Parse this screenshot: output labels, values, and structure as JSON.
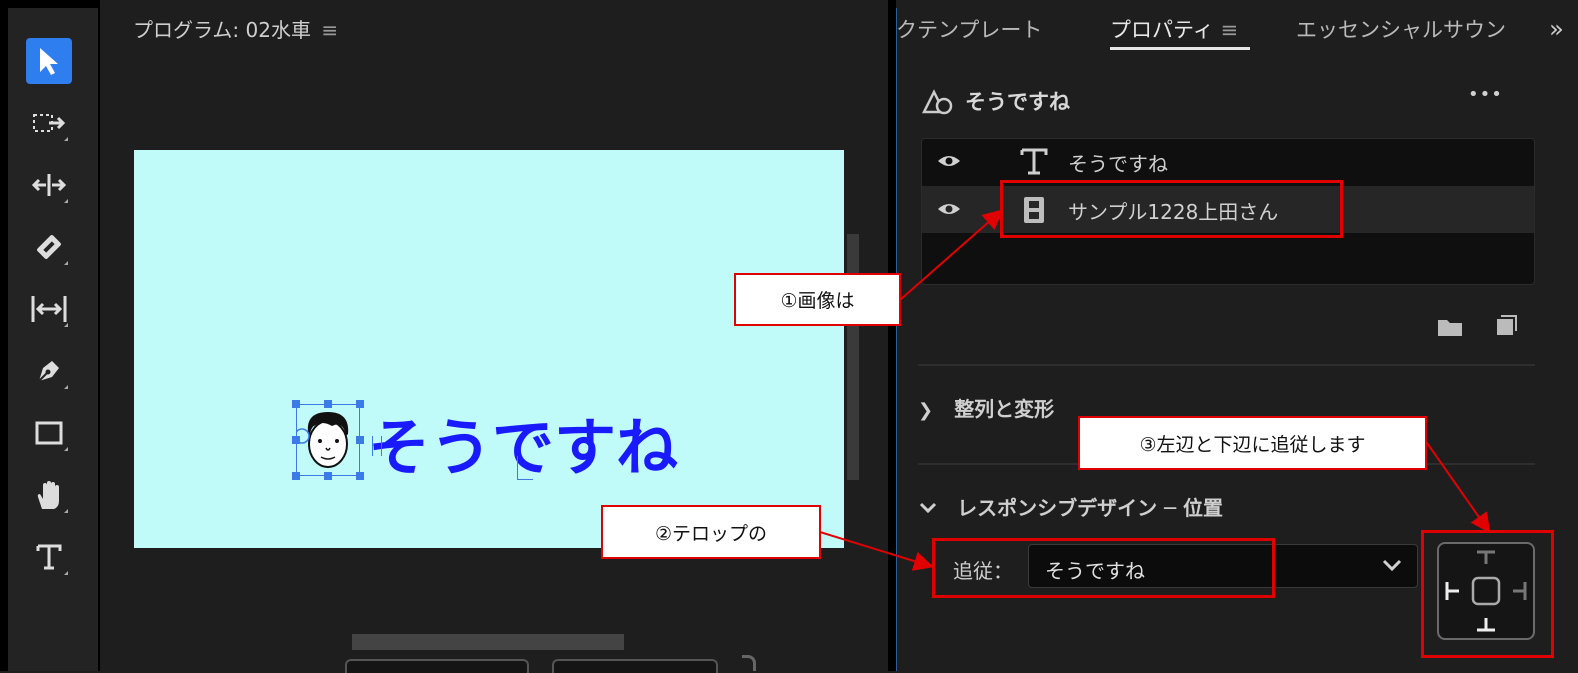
{
  "program": {
    "title": "プログラム: 02水車",
    "menu_icon": "≡"
  },
  "canvas": {
    "title_text": "そうですね"
  },
  "tabs": {
    "left_partial": "クテンプレート",
    "active": "プロパティ",
    "right_partial": "エッセンシャルサウン",
    "more": "»"
  },
  "properties": {
    "clip_name": "そうですね",
    "more_icon": "•••",
    "layers": [
      {
        "label": "そうですね",
        "type_icon": "text-icon"
      },
      {
        "label": "サンプル1228上田さん",
        "type_icon": "film-icon"
      }
    ]
  },
  "sections": {
    "align": "整列と変形",
    "responsive": "レスポンシブデザイン ─ 位置"
  },
  "follow": {
    "label": "追従：",
    "value": "そうですね"
  },
  "annotations": {
    "c1": "①画像は",
    "c2": "②テロップの",
    "c3": "③左辺と下辺に追従します"
  },
  "colors": {
    "accent": "#2f7ef0",
    "canvas_bg": "#c0fbf9",
    "title_text": "#1a1aff",
    "annotation": "#e00000"
  }
}
